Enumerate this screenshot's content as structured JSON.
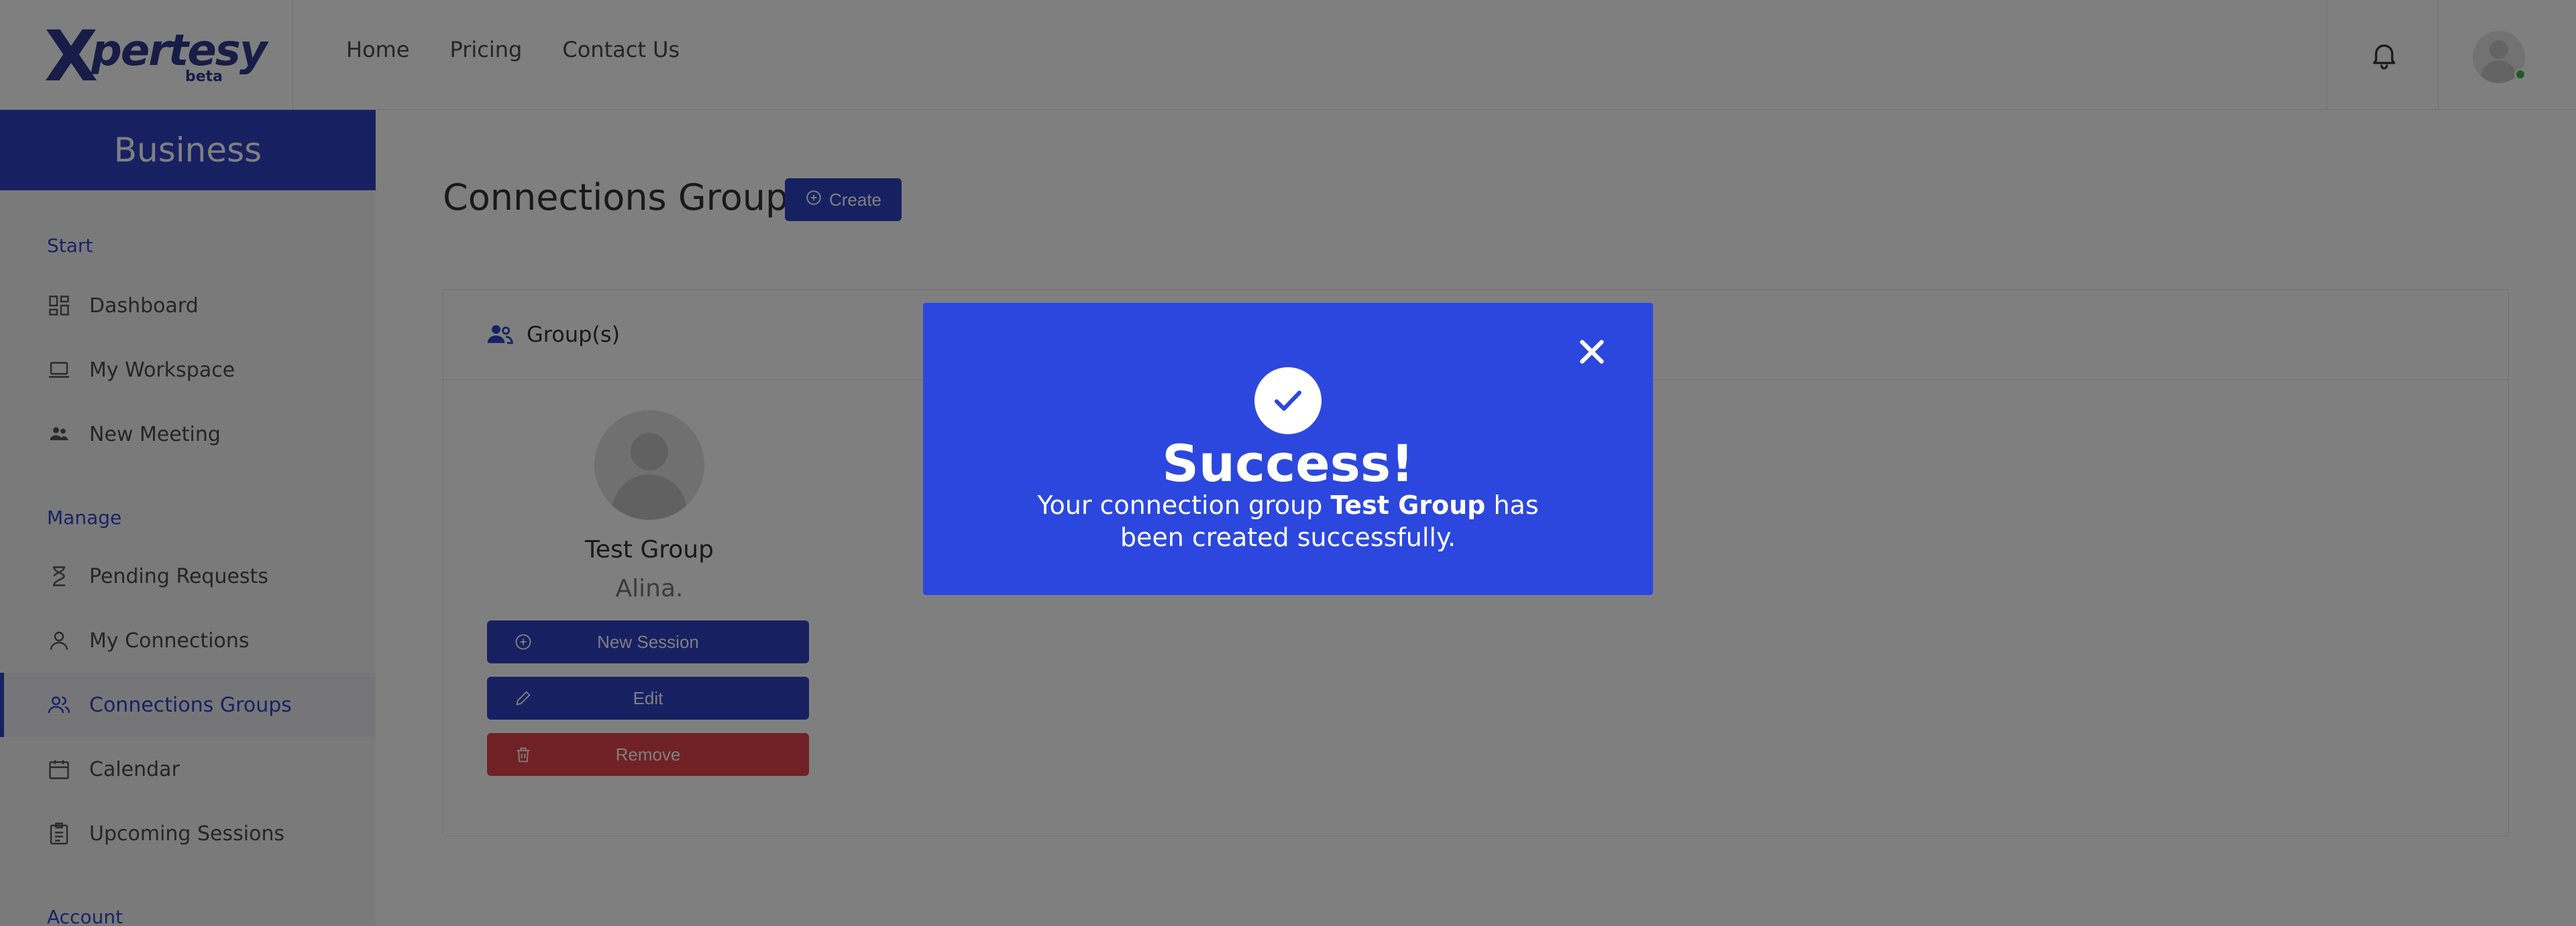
{
  "topbar": {
    "logo_letter": "X",
    "logo_text": "pertesy",
    "logo_badge": "beta",
    "nav": [
      "Home",
      "Pricing",
      "Contact Us"
    ]
  },
  "sidebar": {
    "header": "Business",
    "sections": [
      {
        "title": "Start",
        "items": [
          "Dashboard",
          "My Workspace",
          "New Meeting"
        ]
      },
      {
        "title": "Manage",
        "items": [
          "Pending Requests",
          "My Connections",
          "Connections Groups",
          "Calendar",
          "Upcoming Sessions"
        ]
      },
      {
        "title": "Account",
        "items": []
      }
    ],
    "active_item": "Connections Groups"
  },
  "main": {
    "title": "Connections Groups",
    "create_label": "Create",
    "card_title": "Group(s)",
    "group": {
      "name": "Test Group",
      "owner": "Alina.",
      "actions": [
        "New Session",
        "Edit",
        "Remove"
      ]
    }
  },
  "modal": {
    "title": "Success!",
    "msg_before": "Your connection group ",
    "msg_group": "Test Group",
    "msg_after": " has been created successfully."
  },
  "colors": {
    "primary": "#2f42c4",
    "modal_bg": "#2c47de",
    "danger": "#e0434b",
    "online": "#4caf50"
  }
}
